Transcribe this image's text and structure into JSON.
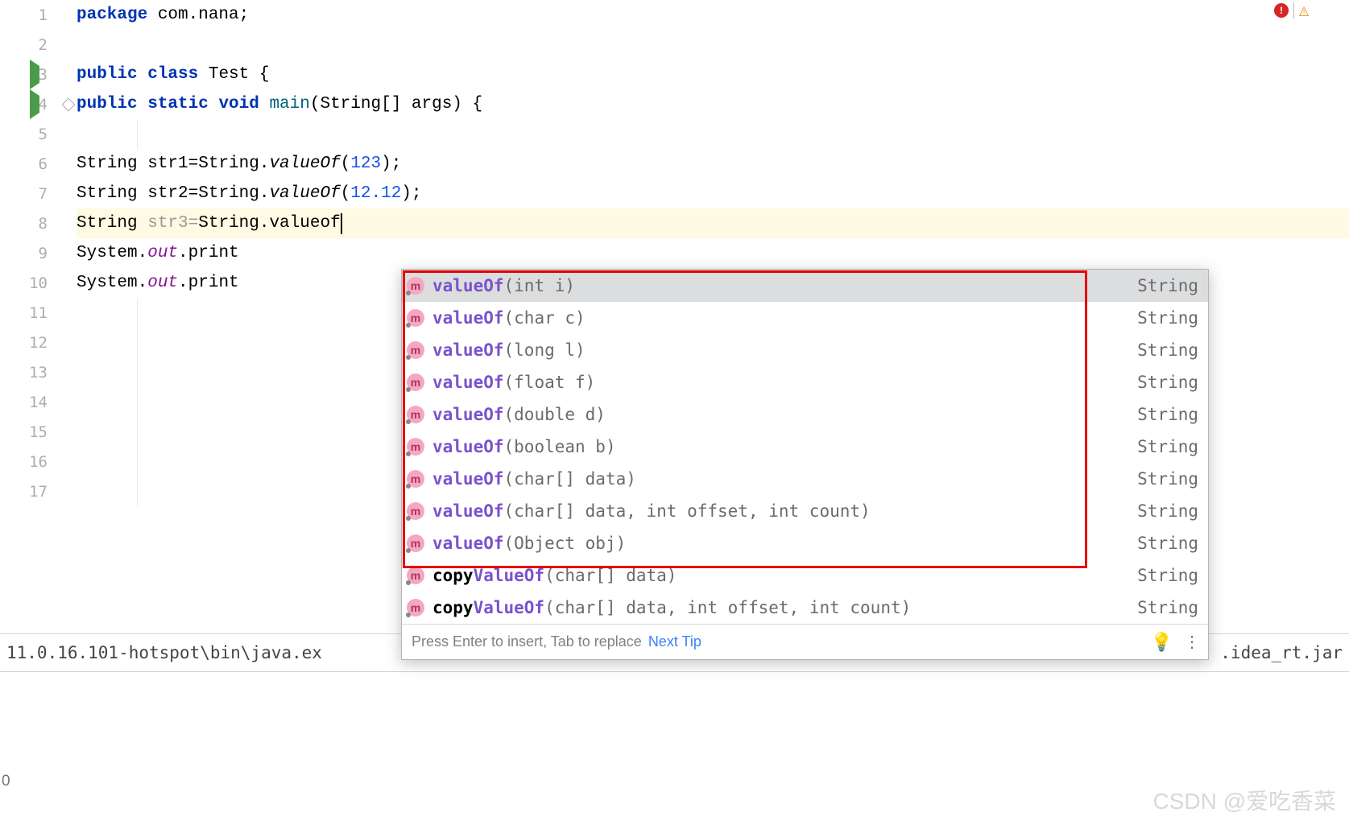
{
  "lines": {
    "l1": {
      "num": "1"
    },
    "l2": {
      "num": "2"
    },
    "l3": {
      "num": "3"
    },
    "l4": {
      "num": "4"
    },
    "l5": {
      "num": "5"
    },
    "l6": {
      "num": "6"
    },
    "l7": {
      "num": "7"
    },
    "l8": {
      "num": "8"
    },
    "l9": {
      "num": "9"
    },
    "l10": {
      "num": "10"
    },
    "l11": {
      "num": "11"
    },
    "l12": {
      "num": "12"
    },
    "l13": {
      "num": "13"
    },
    "l14": {
      "num": "14"
    },
    "l15": {
      "num": "15"
    },
    "l16": {
      "num": "16"
    },
    "l17": {
      "num": "17"
    }
  },
  "code": {
    "package_kw": "package",
    "package_name": " com.nana;",
    "public_kw": "public ",
    "class_kw": "class ",
    "class_name": "Test ",
    "brace_open": "{",
    "static_kw": "static ",
    "void_kw": "void ",
    "main_name": "main",
    "main_params": "(String[] args) ",
    "string_type": "String ",
    "str1_var": "str1=",
    "string_class": "String.",
    "valueof_it": "valueOf",
    "paren_open": "(",
    "num_123": "123",
    "paren_close_semi": ");",
    "str2_var": "str2=",
    "num_1212": "12.12",
    "str3_var": "str3=",
    "valueof_lower": "valueof",
    "system_out": "System.",
    "out_field": "out",
    "print_method": ".print"
  },
  "popup": {
    "items": [
      {
        "method": "valueOf",
        "params": "(int i)",
        "ret": "String",
        "highlighted_part": "valueOf"
      },
      {
        "method": "valueOf",
        "params": "(char c)",
        "ret": "String",
        "highlighted_part": "valueOf"
      },
      {
        "method": "valueOf",
        "params": "(long l)",
        "ret": "String",
        "highlighted_part": "valueOf"
      },
      {
        "method": "valueOf",
        "params": "(float f)",
        "ret": "String",
        "highlighted_part": "valueOf"
      },
      {
        "method": "valueOf",
        "params": "(double d)",
        "ret": "String",
        "highlighted_part": "valueOf"
      },
      {
        "method": "valueOf",
        "params": "(boolean b)",
        "ret": "String",
        "highlighted_part": "valueOf"
      },
      {
        "method": "valueOf",
        "params": "(char[] data)",
        "ret": "String",
        "highlighted_part": "valueOf"
      },
      {
        "method": "valueOf",
        "params": "(char[] data, int offset, int count)",
        "ret": "String",
        "highlighted_part": "valueOf"
      },
      {
        "method": "valueOf",
        "params": "(Object obj)",
        "ret": "String",
        "highlighted_part": "valueOf"
      },
      {
        "method_prefix": "copy",
        "method": "ValueOf",
        "params": "(char[] data)",
        "ret": "String"
      },
      {
        "method_prefix": "copy",
        "method": "ValueOf",
        "params": "(char[] data, int offset, int count)",
        "ret": "String"
      }
    ],
    "footer_hint": "Press Enter to insert, Tab to replace",
    "footer_link": "Next Tip",
    "icon_letter": "m"
  },
  "bottom": {
    "left_text": "11.0.16.101-hotspot\\bin\\java.ex",
    "right_text": ".idea_rt.jar"
  },
  "status": {
    "cursor": "0"
  },
  "error_badge": {
    "icon": "!"
  },
  "watermark": "CSDN @爱吃香菜"
}
